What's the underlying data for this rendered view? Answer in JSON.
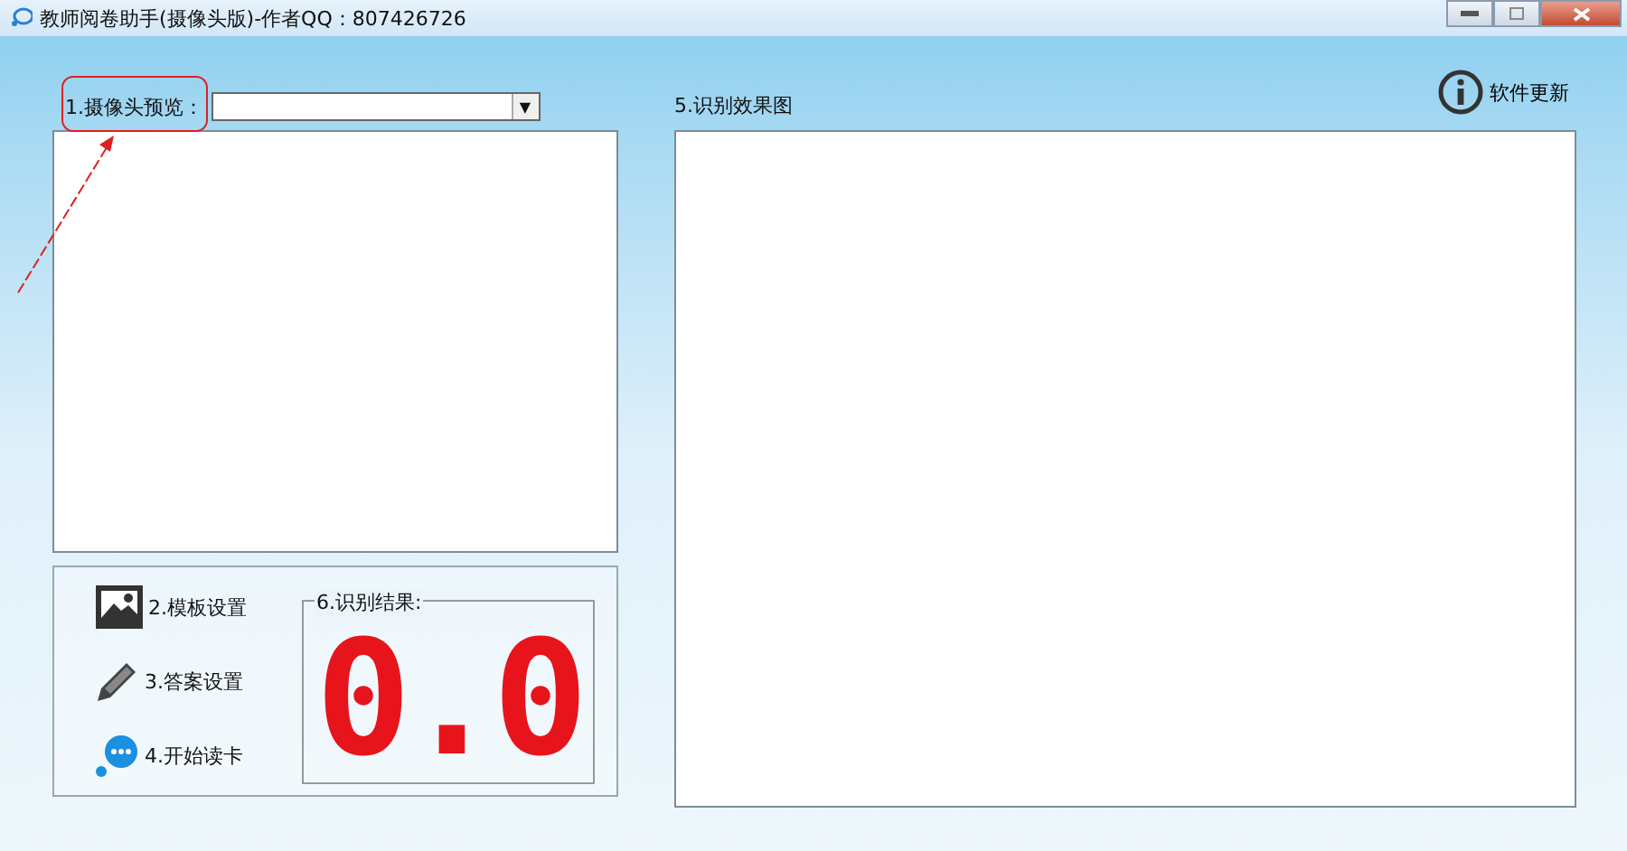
{
  "window": {
    "title": "教师阅卷助手(摄像头版)-作者QQ：807426726",
    "controls": [
      {
        "kind": "minimize"
      },
      {
        "kind": "maximize"
      },
      {
        "kind": "close"
      }
    ]
  },
  "camera_preview": {
    "label": "1.摄像头预览：",
    "dropdown_arrow": "▼"
  },
  "recognition_image": {
    "label": "5.识别效果图"
  },
  "update": {
    "label": "软件更新"
  },
  "actions": [
    {
      "kind": "picture",
      "label": "2.模板设置"
    },
    {
      "kind": "pencil",
      "label": "3.答案设置"
    },
    {
      "kind": "chat",
      "label": "4.开始读卡"
    }
  ],
  "result": {
    "label": "6.识别结果:",
    "value": "0.0"
  },
  "annotation": {
    "kind": "highlight"
  }
}
